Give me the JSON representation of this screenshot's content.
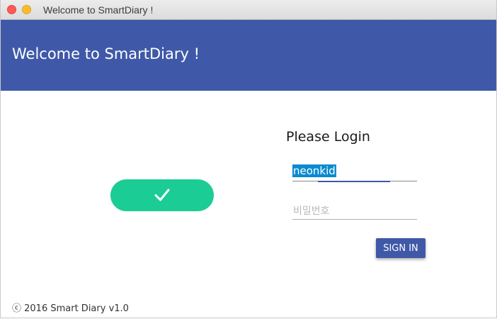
{
  "window": {
    "title": "Welcome to SmartDiary !"
  },
  "appbar": {
    "title": "Welcome to SmartDiary !",
    "color": "#3f59a8"
  },
  "status_toggle": {
    "icon": "check-icon",
    "color": "#1ccc95"
  },
  "login": {
    "heading": "Please Login",
    "username_value": "neonkid",
    "password_placeholder": "비밀번호",
    "signin_label": "SIGN IN"
  },
  "footer": {
    "text": "ⓒ 2016 Smart Diary v1.0"
  }
}
